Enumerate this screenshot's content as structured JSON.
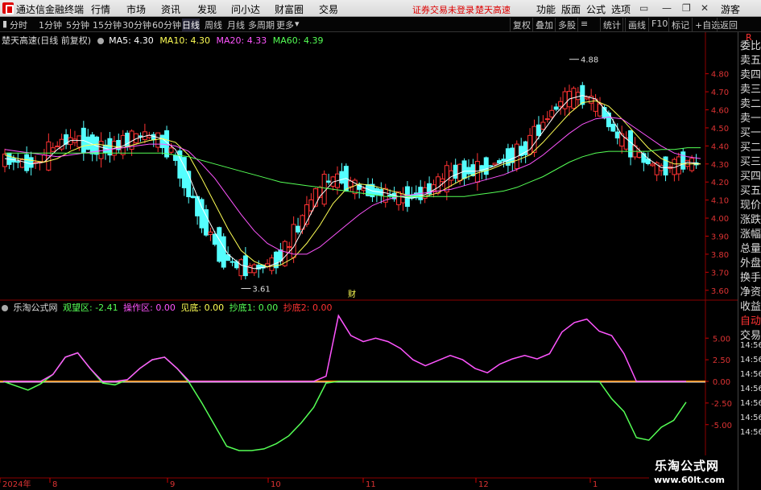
{
  "menubar": {
    "app_name": "通达信金融终端",
    "menus": [
      "行情",
      "市场",
      "资讯",
      "发现",
      "问小达",
      "财富圈",
      "交易"
    ],
    "login_status": "证券交易未登录",
    "stock_name": "楚天高速",
    "right_menus": [
      "功能",
      "版面",
      "公式",
      "选项"
    ],
    "guest": "游客"
  },
  "toolbar": {
    "periods": [
      "分时",
      "1分钟",
      "5分钟",
      "15分钟",
      "30分钟",
      "60分钟",
      "日线",
      "周线",
      "月线",
      "多周期",
      "更多"
    ],
    "active_period": "日线",
    "right_buttons": [
      "复权",
      "叠加",
      "多股",
      "统计",
      "画线",
      "F10",
      "标记",
      "+自选",
      "返回"
    ]
  },
  "chart": {
    "header": "楚天高速(日线 前复权)",
    "ma": [
      {
        "label": "MA5: 4.30",
        "color": "#ffffff"
      },
      {
        "label": "MA10: 4.30",
        "color": "#ffff55"
      },
      {
        "label": "MA20: 4.33",
        "color": "#ff55ff"
      },
      {
        "label": "MA60: 4.39",
        "color": "#55ff55"
      }
    ],
    "high_label": "4.88",
    "low_label": "3.61",
    "cai_label": "财"
  },
  "indicator": {
    "name": "乐淘公式网",
    "items": [
      {
        "label": "观望区: -2.41",
        "color": "#55ff55"
      },
      {
        "label": "操作区: 0.00",
        "color": "#ff55ff"
      },
      {
        "label": "见底: 0.00",
        "color": "#ffff55"
      },
      {
        "label": "抄底1: 0.00",
        "color": "#55ff55"
      },
      {
        "label": "抄底2: 0.00",
        "color": "#ff3333"
      }
    ]
  },
  "xaxis": {
    "labels": [
      "2024年",
      "8",
      "9",
      "10",
      "11",
      "12",
      "1"
    ]
  },
  "sidebar": {
    "items": [
      "R",
      "委比",
      "卖五",
      "卖四",
      "卖三",
      "卖二",
      "卖一",
      "买一",
      "买二",
      "买三",
      "买四",
      "买五",
      "现价",
      "涨跌",
      "涨幅",
      "总量",
      "外盘",
      "换手",
      "净资",
      "收益",
      "自动",
      "交易",
      "14:56",
      "14:56",
      "14:56",
      "14:56",
      "14:56",
      "14:56",
      "14:56"
    ]
  },
  "watermark": {
    "title": "乐淘公式网",
    "url": "www.60lt.com"
  },
  "chart_data": [
    {
      "type": "candlestick",
      "title": "楚天高速(日线 前复权)",
      "ylim": [
        3.55,
        4.95
      ],
      "yticks": [
        "4.80",
        "4.70",
        "4.60",
        "4.50",
        "4.40",
        "4.30",
        "4.20",
        "4.10",
        "4.00",
        "3.90",
        "3.80",
        "3.70",
        "3.60"
      ],
      "series": [
        {
          "name": "MA5",
          "values": [
            4.33,
            4.32,
            4.3,
            4.31,
            4.38,
            4.43,
            4.43,
            4.4,
            4.38,
            4.4,
            4.44,
            4.46,
            4.44,
            4.38,
            4.24,
            4.06,
            3.92,
            3.8,
            3.74,
            3.72,
            3.73,
            3.76,
            3.84,
            3.98,
            4.12,
            4.2,
            4.22,
            4.18,
            4.15,
            4.14,
            4.12,
            4.11,
            4.13,
            4.17,
            4.23,
            4.26,
            4.26,
            4.28,
            4.31,
            4.34,
            4.38,
            4.48,
            4.58,
            4.66,
            4.68,
            4.66,
            4.58,
            4.46,
            4.4,
            4.33,
            4.28,
            4.28,
            4.31,
            4.3
          ]
        },
        {
          "name": "MA10",
          "values": [
            4.35,
            4.33,
            4.32,
            4.31,
            4.33,
            4.37,
            4.4,
            4.41,
            4.4,
            4.39,
            4.41,
            4.43,
            4.44,
            4.42,
            4.35,
            4.22,
            4.08,
            3.94,
            3.82,
            3.76,
            3.73,
            3.74,
            3.78,
            3.86,
            3.96,
            4.08,
            4.16,
            4.19,
            4.18,
            4.16,
            4.14,
            4.12,
            4.12,
            4.14,
            4.18,
            4.22,
            4.25,
            4.27,
            4.3,
            4.32,
            4.35,
            4.42,
            4.5,
            4.58,
            4.64,
            4.65,
            4.62,
            4.55,
            4.47,
            4.39,
            4.33,
            4.3,
            4.3,
            4.3
          ]
        },
        {
          "name": "MA20",
          "values": [
            4.38,
            4.37,
            4.36,
            4.35,
            4.34,
            4.35,
            4.36,
            4.37,
            4.38,
            4.39,
            4.4,
            4.41,
            4.41,
            4.4,
            4.37,
            4.3,
            4.22,
            4.12,
            4.02,
            3.93,
            3.86,
            3.82,
            3.8,
            3.8,
            3.84,
            3.9,
            3.96,
            4.02,
            4.07,
            4.1,
            4.12,
            4.13,
            4.14,
            4.15,
            4.16,
            4.18,
            4.2,
            4.22,
            4.24,
            4.27,
            4.3,
            4.35,
            4.41,
            4.47,
            4.52,
            4.55,
            4.56,
            4.55,
            4.5,
            4.45,
            4.4,
            4.36,
            4.34,
            4.33
          ]
        },
        {
          "name": "MA60",
          "values": [
            4.36,
            4.36,
            4.36,
            4.36,
            4.36,
            4.36,
            4.36,
            4.36,
            4.36,
            4.36,
            4.36,
            4.36,
            4.36,
            4.35,
            4.34,
            4.32,
            4.3,
            4.28,
            4.26,
            4.24,
            4.22,
            4.2,
            4.19,
            4.18,
            4.17,
            4.16,
            4.15,
            4.14,
            4.13,
            4.12,
            4.12,
            4.12,
            4.12,
            4.12,
            4.12,
            4.12,
            4.13,
            4.14,
            4.15,
            4.17,
            4.2,
            4.23,
            4.27,
            4.31,
            4.34,
            4.36,
            4.37,
            4.37,
            4.37,
            4.37,
            4.38,
            4.38,
            4.39,
            4.39
          ]
        }
      ]
    },
    {
      "type": "line",
      "title": "乐淘公式网",
      "ylim": [
        -8,
        8
      ],
      "yticks": [
        "5.00",
        "2.50",
        "0.00",
        "-2.50",
        "-5.00"
      ],
      "series": [
        {
          "name": "观望区",
          "values": [
            0,
            -0.5,
            -1,
            -0.3,
            0.8,
            2.8,
            3.3,
            1.5,
            -0.2,
            -0.4,
            0.2,
            1.5,
            2.5,
            2.8,
            1.5,
            -0.2,
            -2.5,
            -5,
            -7.5,
            -8,
            -8,
            -7.8,
            -7.2,
            -6.3,
            -4.8,
            -3,
            -0.2,
            0,
            0,
            0,
            0,
            0,
            0,
            0,
            0,
            0,
            0,
            0,
            0,
            0,
            0,
            0,
            0,
            0,
            0,
            0,
            0,
            0,
            0,
            -2,
            -3.5,
            -6.5,
            -6.8,
            -5.3,
            -4.5,
            -2.4
          ]
        },
        {
          "name": "操作区",
          "values": [
            0,
            0,
            0,
            0,
            0.8,
            2.8,
            3.3,
            1.5,
            0,
            0,
            0.2,
            1.5,
            2.5,
            2.8,
            1.5,
            0,
            0,
            0,
            0,
            0,
            0,
            0,
            0,
            0,
            0,
            0,
            0.6,
            7.6,
            5.3,
            4.6,
            5,
            4.6,
            3.8,
            2.5,
            1.8,
            2.4,
            3,
            2.5,
            1.5,
            1,
            2,
            2.6,
            3,
            2.6,
            3.2,
            5.7,
            6.8,
            7.2,
            5.8,
            5.3,
            3.2,
            0,
            0,
            0,
            0,
            0
          ]
        }
      ]
    }
  ]
}
